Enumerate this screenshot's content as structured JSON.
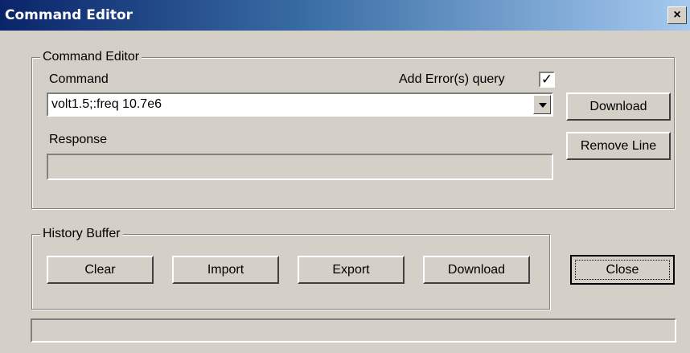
{
  "window": {
    "title": "Command Editor",
    "close_glyph": "×"
  },
  "command_group": {
    "legend": "Command Editor",
    "command_label": "Command",
    "add_error_label": "Add Error(s) query",
    "add_error_checked": true,
    "add_error_glyph": "✓",
    "command_value": "volt1.5;:freq 10.7e6",
    "response_label": "Response",
    "response_value": "",
    "download_label": "Download",
    "remove_line_label": "Remove Line"
  },
  "history_group": {
    "legend": "History Buffer",
    "clear_label": "Clear",
    "import_label": "Import",
    "export_label": "Export",
    "download_label": "Download"
  },
  "close_label": "Close",
  "status_text": ""
}
